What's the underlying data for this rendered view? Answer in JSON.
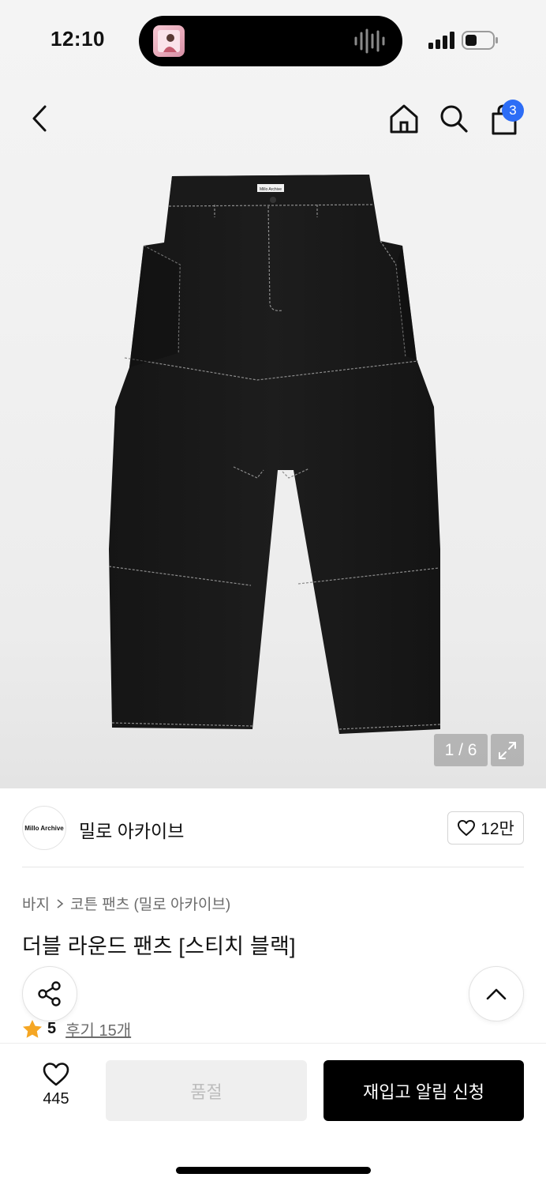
{
  "status_bar": {
    "time": "12:10"
  },
  "header": {
    "cart_count": "3"
  },
  "gallery": {
    "counter": "1 / 6",
    "garment_label": "Millo Archive"
  },
  "brand": {
    "logo_text": "Millo Archive",
    "name": "밀로 아카이브",
    "like_count": "12만"
  },
  "product": {
    "breadcrumb": [
      "바지",
      "코튼 팬츠 (밀로 아카이브)"
    ],
    "title": "더블 라운드 팬츠 [스티치 블랙]",
    "rating": "5",
    "review_link": "후기 15개"
  },
  "bottom_bar": {
    "wish_count": "445",
    "soldout_label": "품절",
    "restock_label": "재입고 알림 신청"
  },
  "colors": {
    "accent_badge": "#2d6df6",
    "star": "#f5a623",
    "primary_button": "#000000"
  }
}
